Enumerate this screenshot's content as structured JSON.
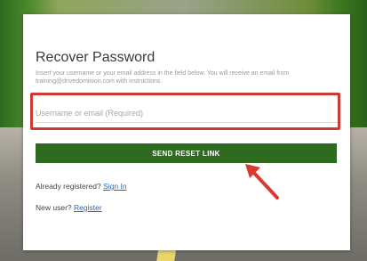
{
  "recover": {
    "title": "Recover Password",
    "instructions": "Insert your username or your email address in the field below. You will receive an email from training@drivedominion.com with instructions.",
    "input_placeholder": "Username or email (Required)",
    "input_value": "",
    "reset_button_label": "SEND RESET LINK",
    "already_registered_text": "Already registered?",
    "sign_in_link": "Sign In",
    "new_user_text": "New user?",
    "register_link": "Register"
  },
  "annotation": {
    "highlight_color": "#cc3b32",
    "arrow_icon": "red-arrow-icon"
  },
  "colors": {
    "button_bg": "#2e6b21",
    "link": "#2b66b3"
  }
}
